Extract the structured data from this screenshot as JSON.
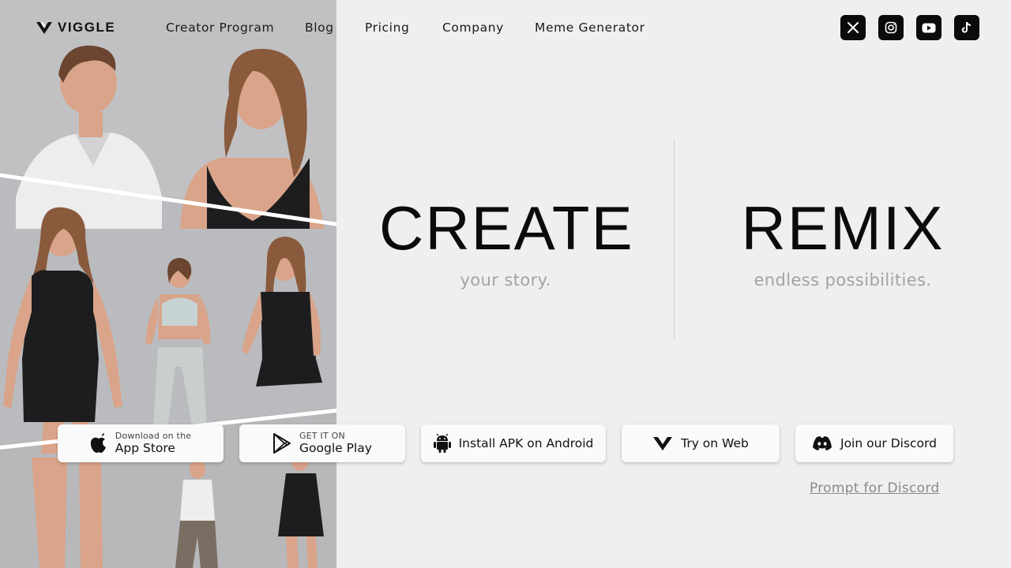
{
  "brand": {
    "name": "VIGGLE"
  },
  "nav": {
    "items": [
      {
        "label": "Creator Program"
      },
      {
        "label": "Blog"
      },
      {
        "label": "Pricing"
      },
      {
        "label": "Company"
      },
      {
        "label": "Meme Generator"
      }
    ]
  },
  "socials": [
    {
      "icon": "x-icon"
    },
    {
      "icon": "instagram-icon"
    },
    {
      "icon": "youtube-icon"
    },
    {
      "icon": "tiktok-icon"
    }
  ],
  "hero": {
    "left": {
      "title": "CREATE",
      "subtitle": "your story."
    },
    "right": {
      "title": "REMIX",
      "subtitle": "endless possibilities."
    }
  },
  "buttons": {
    "app_store": {
      "small": "Download on the",
      "big": "App Store",
      "icon": "apple-icon"
    },
    "google_play": {
      "small": "GET IT ON",
      "big": "Google Play",
      "icon": "google-play-icon"
    },
    "apk": {
      "label": "Install APK on Android",
      "icon": "android-icon"
    },
    "web": {
      "label": "Try on Web",
      "icon": "viggle-logo-icon"
    },
    "discord": {
      "label": "Join our Discord",
      "icon": "discord-icon"
    }
  },
  "prompt_link": {
    "label": "Prompt for Discord"
  },
  "colors": {
    "background": "#efefef",
    "button_bg": "#fafafa",
    "icon_bg": "#0b0b0b",
    "muted_text": "#a3a3a3"
  }
}
